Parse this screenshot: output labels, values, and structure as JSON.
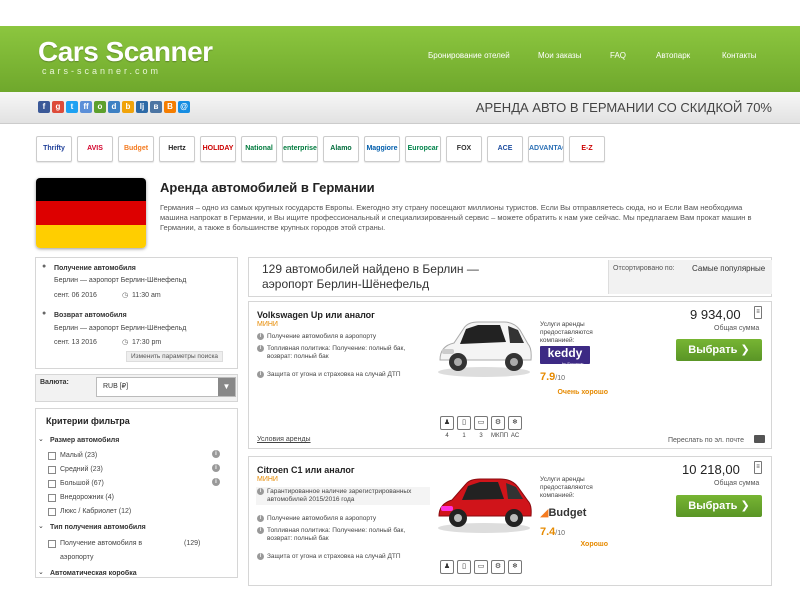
{
  "header": {
    "logo": "Cars Scanner",
    "logo_sub": "cars-scanner.com",
    "nav": [
      "Бронирование отелей",
      "Мои заказы",
      "FAQ",
      "Автопарк",
      "Контакты"
    ]
  },
  "social_icons": [
    {
      "name": "facebook-icon",
      "glyph": "f",
      "color": "#3b5998"
    },
    {
      "name": "google-plus-icon",
      "glyph": "g",
      "color": "#dd4b39"
    },
    {
      "name": "twitter-icon",
      "glyph": "t",
      "color": "#1da1f2"
    },
    {
      "name": "friendfeed-icon",
      "glyph": "ff",
      "color": "#5b8fd8"
    },
    {
      "name": "odnoklassniki-icon",
      "glyph": "о",
      "color": "#5da02c"
    },
    {
      "name": "diigo-icon",
      "glyph": "d",
      "color": "#3d80c3"
    },
    {
      "name": "bookmark-icon",
      "glyph": "b",
      "color": "#f0a30a"
    },
    {
      "name": "livejournal-icon",
      "glyph": "lj",
      "color": "#2d6aa7"
    },
    {
      "name": "vk-icon",
      "glyph": "в",
      "color": "#4c75a3"
    },
    {
      "name": "blogger-icon",
      "glyph": "B",
      "color": "#f57d00"
    },
    {
      "name": "mail-icon",
      "glyph": "@",
      "color": "#168de2"
    }
  ],
  "tagline": "АРЕНДА АВТО В ГЕРМАНИИ СО СКИДКОЙ 70%",
  "brands": [
    {
      "label": "Thrifty",
      "color": "#1f3f99"
    },
    {
      "label": "AVIS",
      "color": "#d4002a"
    },
    {
      "label": "Budget",
      "color": "#f47b20"
    },
    {
      "label": "Hertz",
      "color": "#222"
    },
    {
      "label": "HOLIDAY",
      "color": "#c00"
    },
    {
      "label": "National",
      "color": "#007a3d"
    },
    {
      "label": "enterprise",
      "color": "#007a3d"
    },
    {
      "label": "Alamo",
      "color": "#006c3b"
    },
    {
      "label": "Maggiore",
      "color": "#005dab"
    },
    {
      "label": "Europcar",
      "color": "#00834a"
    },
    {
      "label": "FOX",
      "color": "#333"
    },
    {
      "label": "ACE",
      "color": "#1f4ea0"
    },
    {
      "label": "ADVANTAGE",
      "color": "#2a6fb5"
    },
    {
      "label": "E-Z",
      "color": "#c00"
    }
  ],
  "intro": {
    "title": "Аренда автомобилей в Германии",
    "text": "Германия – одно из самых крупных государств Европы. Ежегодно эту страну посещают миллионы туристов. Если Вы отправляетесь сюда, но и Если Вам необходима машина напрокат в Германии, и Вы ищите профессиональный и специализированный сервис – можете обратить к нам уже сейчас. Мы предлагаем Вам прокат машин в Германии, а также в большинстве крупных городов этой страны."
  },
  "search": {
    "pickup_label": "Получение автомобиля",
    "pickup_location": "Берлин — аэропорт Берлин-Шёнефельд",
    "pickup_date": "сент. 06 2016",
    "pickup_time": "11:30 am",
    "return_label": "Возврат автомобиля",
    "return_location": "Берлин — аэропорт Берлин-Шёнефельд",
    "return_date": "сент. 13 2016",
    "return_time": "17:30 pm",
    "change_button": "Изменить параметры поиска"
  },
  "currency": {
    "label": "Валюта:",
    "value": "RUB [₽]",
    "arrow": "▼"
  },
  "filters": {
    "title": "Критерии фильтра",
    "size_group": "Размер автомобиля",
    "size_items": [
      {
        "label": "Малый (23)"
      },
      {
        "label": "Средний (23)"
      },
      {
        "label": "Большой (67)"
      },
      {
        "label": "Внедорожник (4)"
      },
      {
        "label": "Люкс / Кабриолет (12)"
      }
    ],
    "pickup_group": "Тип получения автомобиля",
    "pickup_item_line1": "Получение автомобиля в",
    "pickup_item_line2": "аэропорту",
    "pickup_item_count": "(129)",
    "more_group": "Автоматическая коробка"
  },
  "results": {
    "found": "129 автомобилей найдено в Берлин — аэропорт Берлин-Шёнефельд",
    "sort_label": "Отсортировано по:",
    "sort_value": "Самые популярные"
  },
  "cars": [
    {
      "name": "Volkswagen Up или аналог",
      "class": "МИНИ",
      "features": [
        "Получение автомобиля в аэропорту",
        "Топливная политика: Получение: полный бак, возврат: полный бак",
        "Защита от угона и страховка на случай ДТП"
      ],
      "supplier_label": "Услуги аренды предоставляются компанией:",
      "supplier": "keddy",
      "supplier_sub": "by Europcar",
      "rating": "7.9",
      "rating_max": "/10",
      "rating_word": "Очень хорошо",
      "price": "9 934,00",
      "price_sub": "Общая сумма",
      "book": "Выбрать",
      "terms": "Условия аренды",
      "email": "Переслать по эл. почте",
      "specs": [
        {
          "icon": "👤",
          "value": "4"
        },
        {
          "icon": "▣",
          "value": "1"
        },
        {
          "icon": "⊓",
          "value": "3"
        },
        {
          "icon": "⚙",
          "value": "МКПП"
        },
        {
          "icon": "❄",
          "value": "AC"
        }
      ]
    },
    {
      "name": "Citroen C1 или аналог",
      "class": "МИНИ",
      "features": [
        "Гарантированное наличие зарегистрированных автомобилей 2015/2016 года",
        "Получение автомобиля в аэропорту",
        "Топливная политика: Получение: полный бак, возврат: полный бак",
        "Защита от угона и страховка на случай ДТП"
      ],
      "supplier_label": "Услуги аренды предоставляются компанией:",
      "supplier": "Budget",
      "rating": "7.4",
      "rating_max": "/10",
      "rating_word": "Хорошо",
      "price": "10 218,00",
      "price_sub": "Общая сумма",
      "book": "Выбрать",
      "specs": [
        {
          "icon": "👤"
        },
        {
          "icon": "▣"
        },
        {
          "icon": "⊓"
        },
        {
          "icon": "⚙"
        },
        {
          "icon": "❄"
        }
      ]
    }
  ],
  "colors": {
    "green": "#6fa82c",
    "orange": "#e68a00",
    "flag_black": "#000000",
    "flag_red": "#dd0000",
    "flag_gold": "#ffce00"
  }
}
